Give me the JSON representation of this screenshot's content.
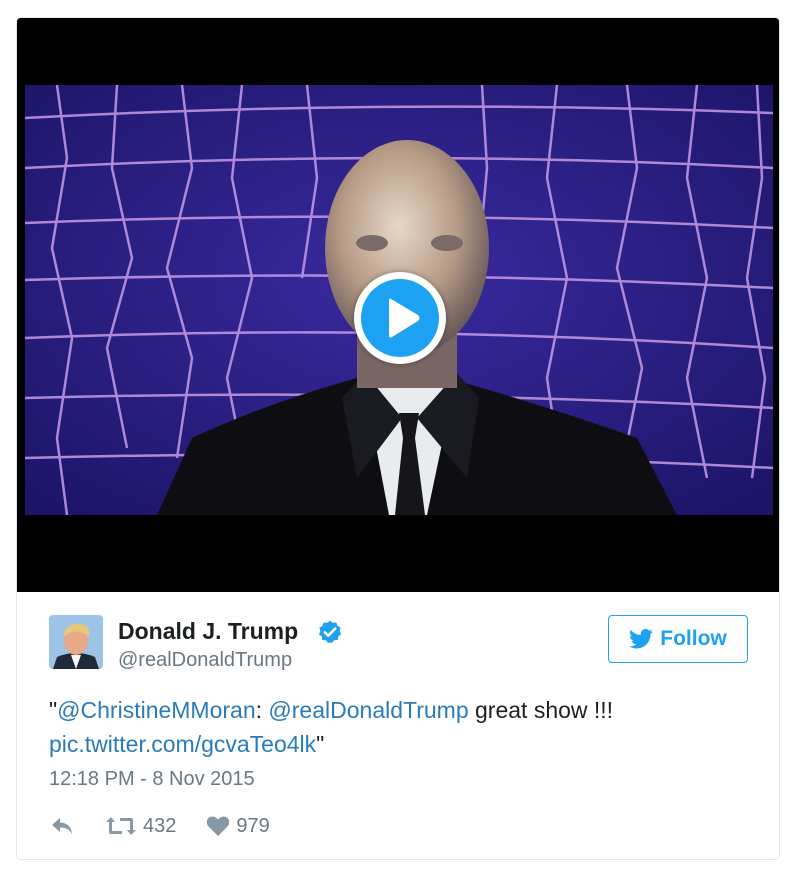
{
  "tweet": {
    "author": {
      "name": "Donald J. Trump",
      "handle": "@realDonaldTrump",
      "verified": true
    },
    "follow_label": "Follow",
    "text": {
      "open_quote": "\"",
      "mention_1": "@ChristineMMoran",
      "separator": ": ",
      "mention_2": "@realDonaldTrump",
      "body": " great show !!!",
      "link": "pic.twitter.com/gcvaTeo4lk",
      "close_quote": "\""
    },
    "timestamp": "12:18 PM - 8 Nov 2015",
    "retweet_count": "432",
    "like_count": "979"
  },
  "media": {
    "type": "video",
    "play_icon": "play-icon"
  },
  "icons": {
    "verified": "verified-badge-icon",
    "follow": "twitter-bird-icon",
    "reply": "reply-icon",
    "retweet": "retweet-icon",
    "like": "heart-icon"
  },
  "colors": {
    "accent": "#1da1f2",
    "link": "#2b7bb9",
    "text": "#1c2022",
    "muted": "#697882",
    "action": "#8899a6",
    "border": "#e1e8ed"
  }
}
